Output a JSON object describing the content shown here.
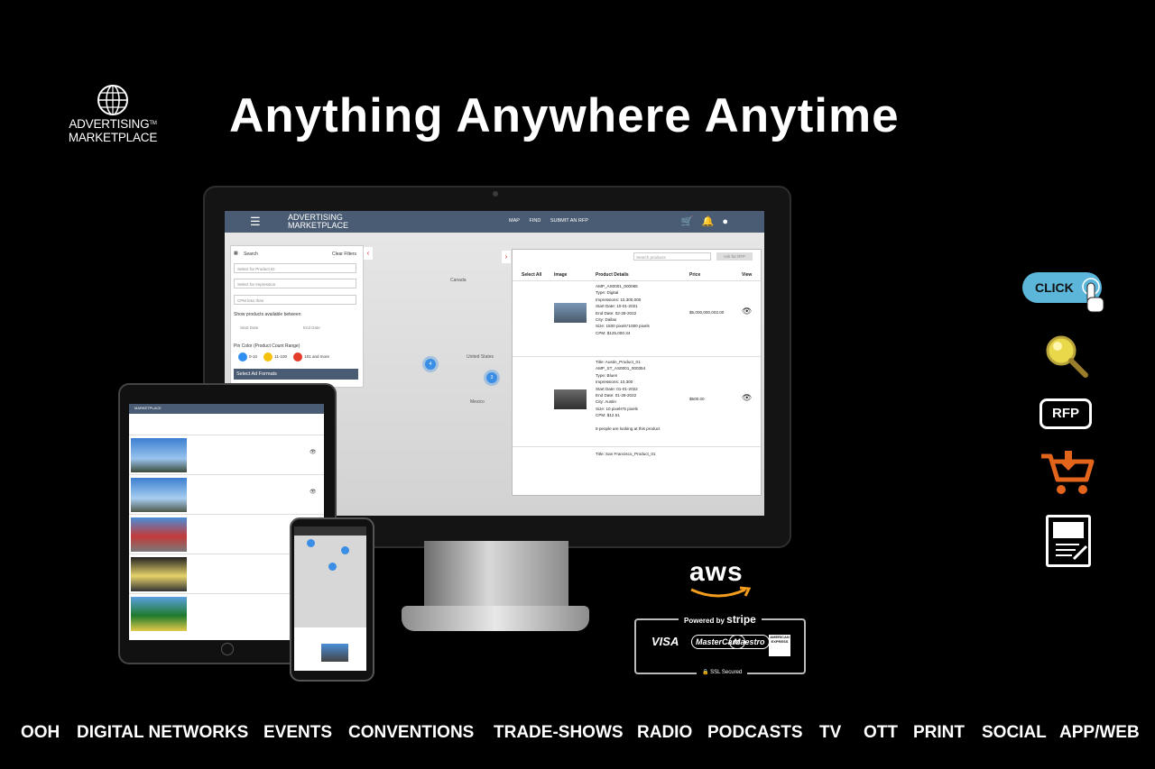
{
  "logo": {
    "line1": "ADVERTISING",
    "line2": "MARKETPLACE",
    "tm": "TM"
  },
  "headline": "Anything  Anywhere  Anytime",
  "desktop": {
    "nav": {
      "brand_line1": "ADVERTISING",
      "brand_line2": "MARKETPLACE",
      "menu": [
        "MAP",
        "FIND",
        "SUBMIT AN RFP"
      ]
    },
    "filters": {
      "title": "Search",
      "clear": "Clear Filters",
      "product_id_placeholder": "Select for Product ID",
      "impressions_placeholder": "Select for Impression",
      "cpm_placeholder": "CPM less than",
      "avail_label": "Show products available between",
      "start_date": "Start Date",
      "end_date": "End Date",
      "pin_color_label": "Pin Color (Product Count Range)",
      "pin_ranges": [
        "0-10",
        "11-100",
        "101 and more"
      ],
      "ad_formats": "Select Ad Formats"
    },
    "map_labels": [
      "Canada",
      "United States",
      "Mexico"
    ],
    "clusters": [
      "4",
      "3"
    ],
    "results": {
      "search_placeholder": "Search products",
      "ask_button": "Ask for RFP",
      "headers": [
        "Select All",
        "Image",
        "Product Details",
        "Price",
        "View"
      ],
      "items": [
        {
          "lines": [
            "AMP_AS0001_000065",
            "Type: Digital",
            "Impressions: 10,300,000",
            "Start Date: 10-01-2021",
            "End Date: 02-28-2022",
            "City: Dallas",
            "Size: 1500 pixels*1000 pixels",
            "CPM: $125,000.34"
          ],
          "price": "$5,000,000,003.00"
        },
        {
          "lines": [
            "Title: Austin_Product_01",
            "AMP_ST_AS0001_000354",
            "Type: Bluen",
            "Impressions: 10,300",
            "Start Date: 01-01-2022",
            "End Date: 01-28-2022",
            "City: Austin",
            "Size: 10 pixels*5 pixels",
            "CPM: $12.51",
            "",
            "9 people are looking at this product"
          ],
          "price": "$500.00"
        },
        {
          "lines": [
            "Title: San Francisco_Product_01"
          ],
          "price": ""
        }
      ]
    }
  },
  "right_icons": {
    "click": "CLICK",
    "rfp": "RFP"
  },
  "payments": {
    "aws": "aws",
    "powered_by": "Powered by",
    "stripe": "stripe",
    "cards": [
      "VISA",
      "MasterCard",
      "Maestro",
      "AMERICAN EXPRESS"
    ],
    "ssl": "SSL Secured"
  },
  "bottom_nav": [
    "OOH",
    "DIGITAL NETWORKS",
    "EVENTS",
    "CONVENTIONS",
    "TRADE-SHOWS",
    "RADIO",
    "PODCASTS",
    "TV",
    "OTT",
    "PRINT",
    "SOCIAL",
    "APP/WEB"
  ]
}
